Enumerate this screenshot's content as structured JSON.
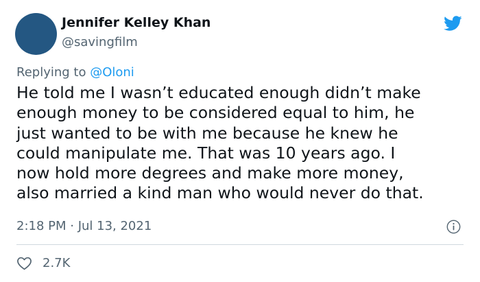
{
  "author": {
    "name": "Jennifer Kelley Khan",
    "handle": "@savingfilm",
    "avatar_color": "#245782"
  },
  "brand": {
    "icon": "twitter-bird-icon",
    "color": "#1d9bf0"
  },
  "reply": {
    "prefix": "Replying to",
    "mention": "@Oloni"
  },
  "tweet": {
    "lines": [
      "He told me I wasn’t educated enough didn’t make",
      "enough money to be considered equal to him, he",
      "just wanted to be with me because he knew he",
      "could manipulate me. That was 10 years ago. I",
      "now hold more degrees and make more money,",
      "also married a kind man who would never do that."
    ],
    "timestamp": "2:18 PM · Jul 13, 2021",
    "info_icon": "info-icon"
  },
  "engagement": {
    "like_icon": "heart-icon",
    "likes": "2.7K"
  }
}
